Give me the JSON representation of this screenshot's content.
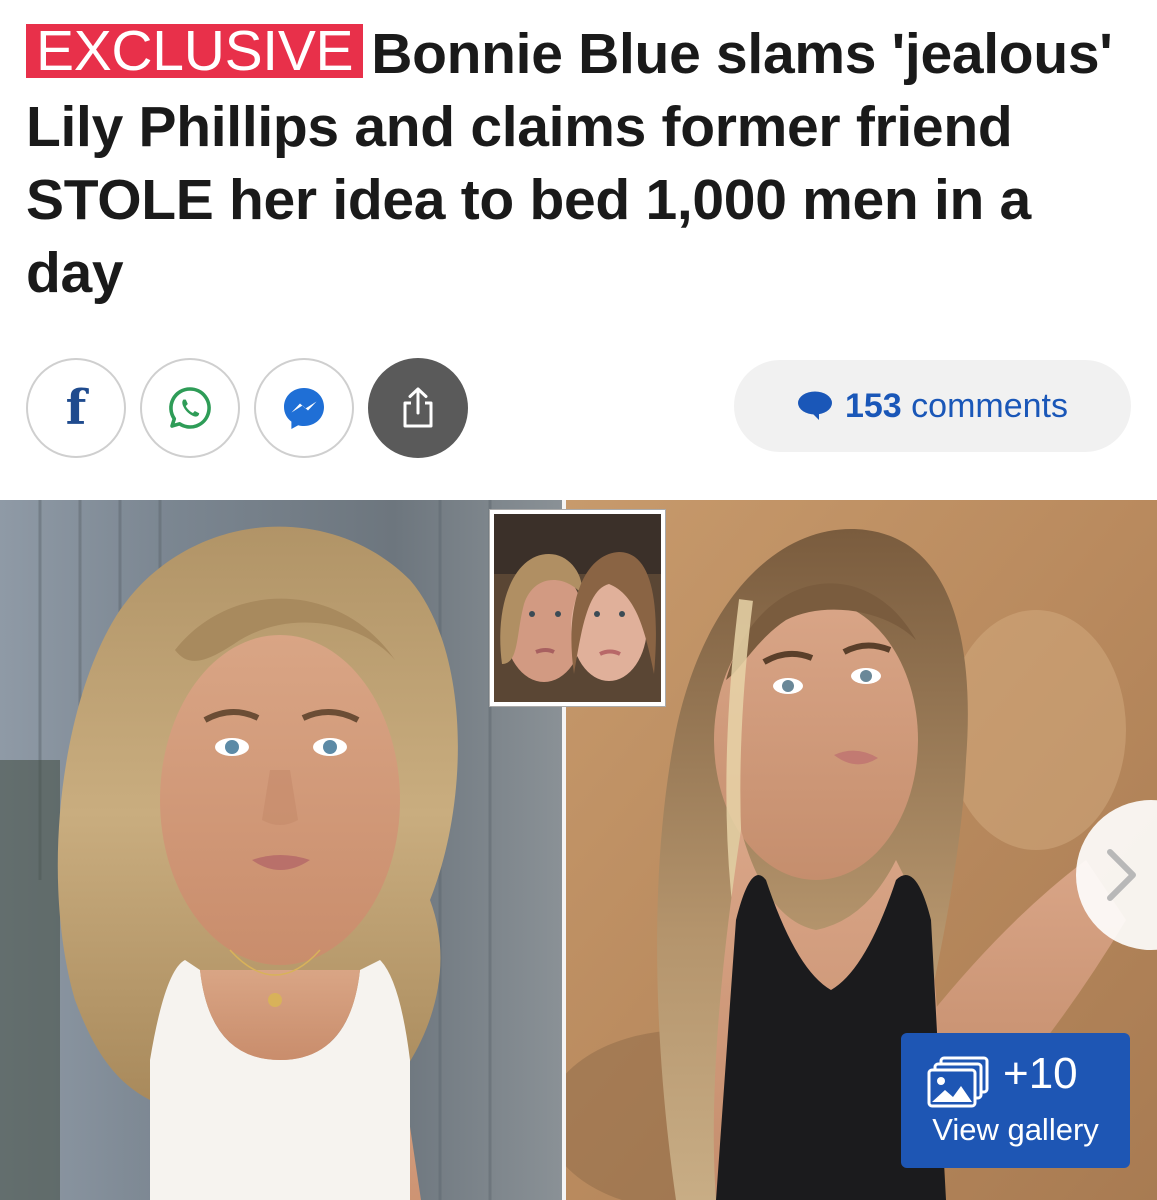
{
  "article": {
    "badge": "EXCLUSIVE",
    "headline": "Bonnie Blue slams 'jealous' Lily Phillips and claims former friend STOLE her idea to bed 1,000 men in a day"
  },
  "share": {
    "facebook_glyph": "f",
    "icons": [
      "facebook-icon",
      "whatsapp-icon",
      "messenger-icon",
      "share-icon"
    ]
  },
  "comments": {
    "count": "153",
    "label": "comments",
    "icon": "speech-bubble-icon"
  },
  "gallery": {
    "count": "+10",
    "label": "View gallery",
    "icon": "gallery-icon"
  },
  "colors": {
    "badge": "#e8304a",
    "link_blue": "#1a57b8",
    "gallery_bg": "#1e56b4",
    "facebook": "#1f4b8e",
    "whatsapp": "#2e9c57",
    "messenger": "#1f6fd6"
  }
}
